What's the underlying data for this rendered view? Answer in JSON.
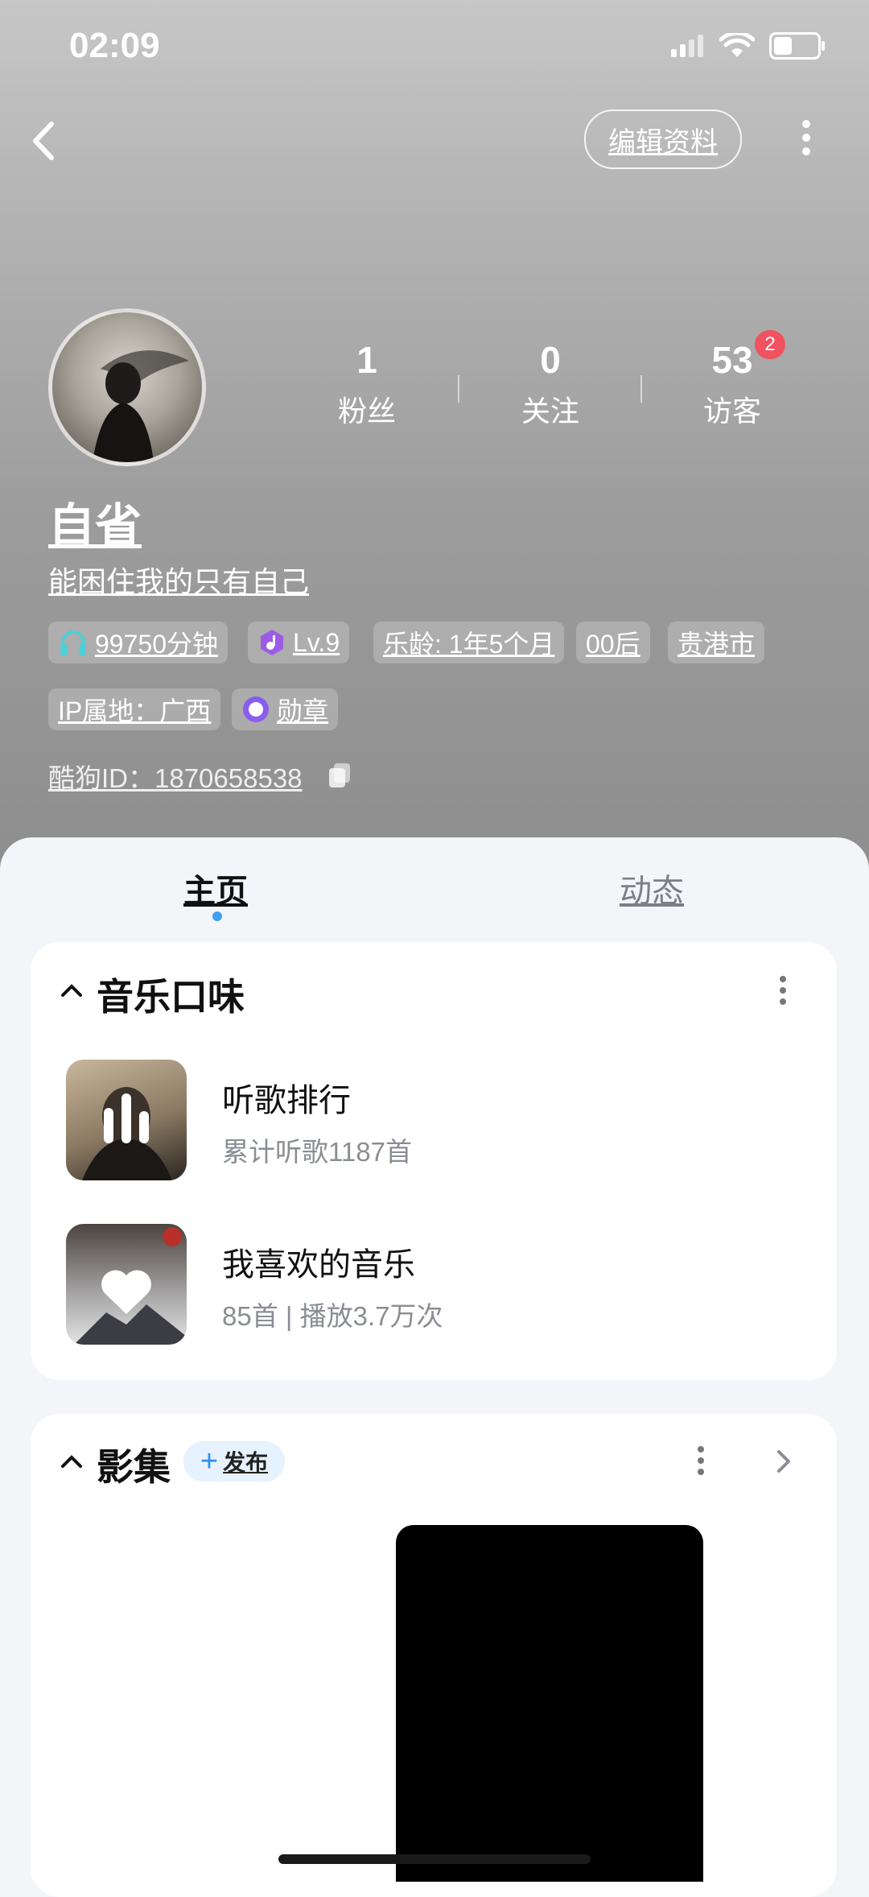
{
  "status_bar": {
    "time": "02:09"
  },
  "header": {
    "edit_profile": "编辑资料"
  },
  "profile": {
    "name": "自省",
    "signature": "能困住我的只有自己",
    "stats": [
      {
        "value": "1",
        "label": "粉丝"
      },
      {
        "value": "0",
        "label": "关注"
      },
      {
        "value": "53",
        "label": "访客",
        "badge": "2"
      }
    ],
    "tags": {
      "listen_time": "99750分钟",
      "level": "Lv.9",
      "music_age": "乐龄: 1年5个月",
      "generation": "00后",
      "city": "贵港市",
      "ip": "IP属地：广西",
      "medal": "勋章"
    },
    "kugou_id": "酷狗ID：1870658538"
  },
  "tabs": {
    "home": "主页",
    "feed": "动态"
  },
  "music_taste": {
    "title": "音乐口味",
    "items": [
      {
        "title": "听歌排行",
        "subtitle": "累计听歌1187首"
      },
      {
        "title": "我喜欢的音乐",
        "subtitle": "85首 | 播放3.7万次"
      }
    ]
  },
  "album": {
    "title": "影集",
    "publish": "发布"
  },
  "colors": {
    "accent": "#3fa0f0",
    "badge": "#f0525f",
    "hero_top": "#c7c7c7",
    "hero_bottom": "#8e8e8e"
  }
}
